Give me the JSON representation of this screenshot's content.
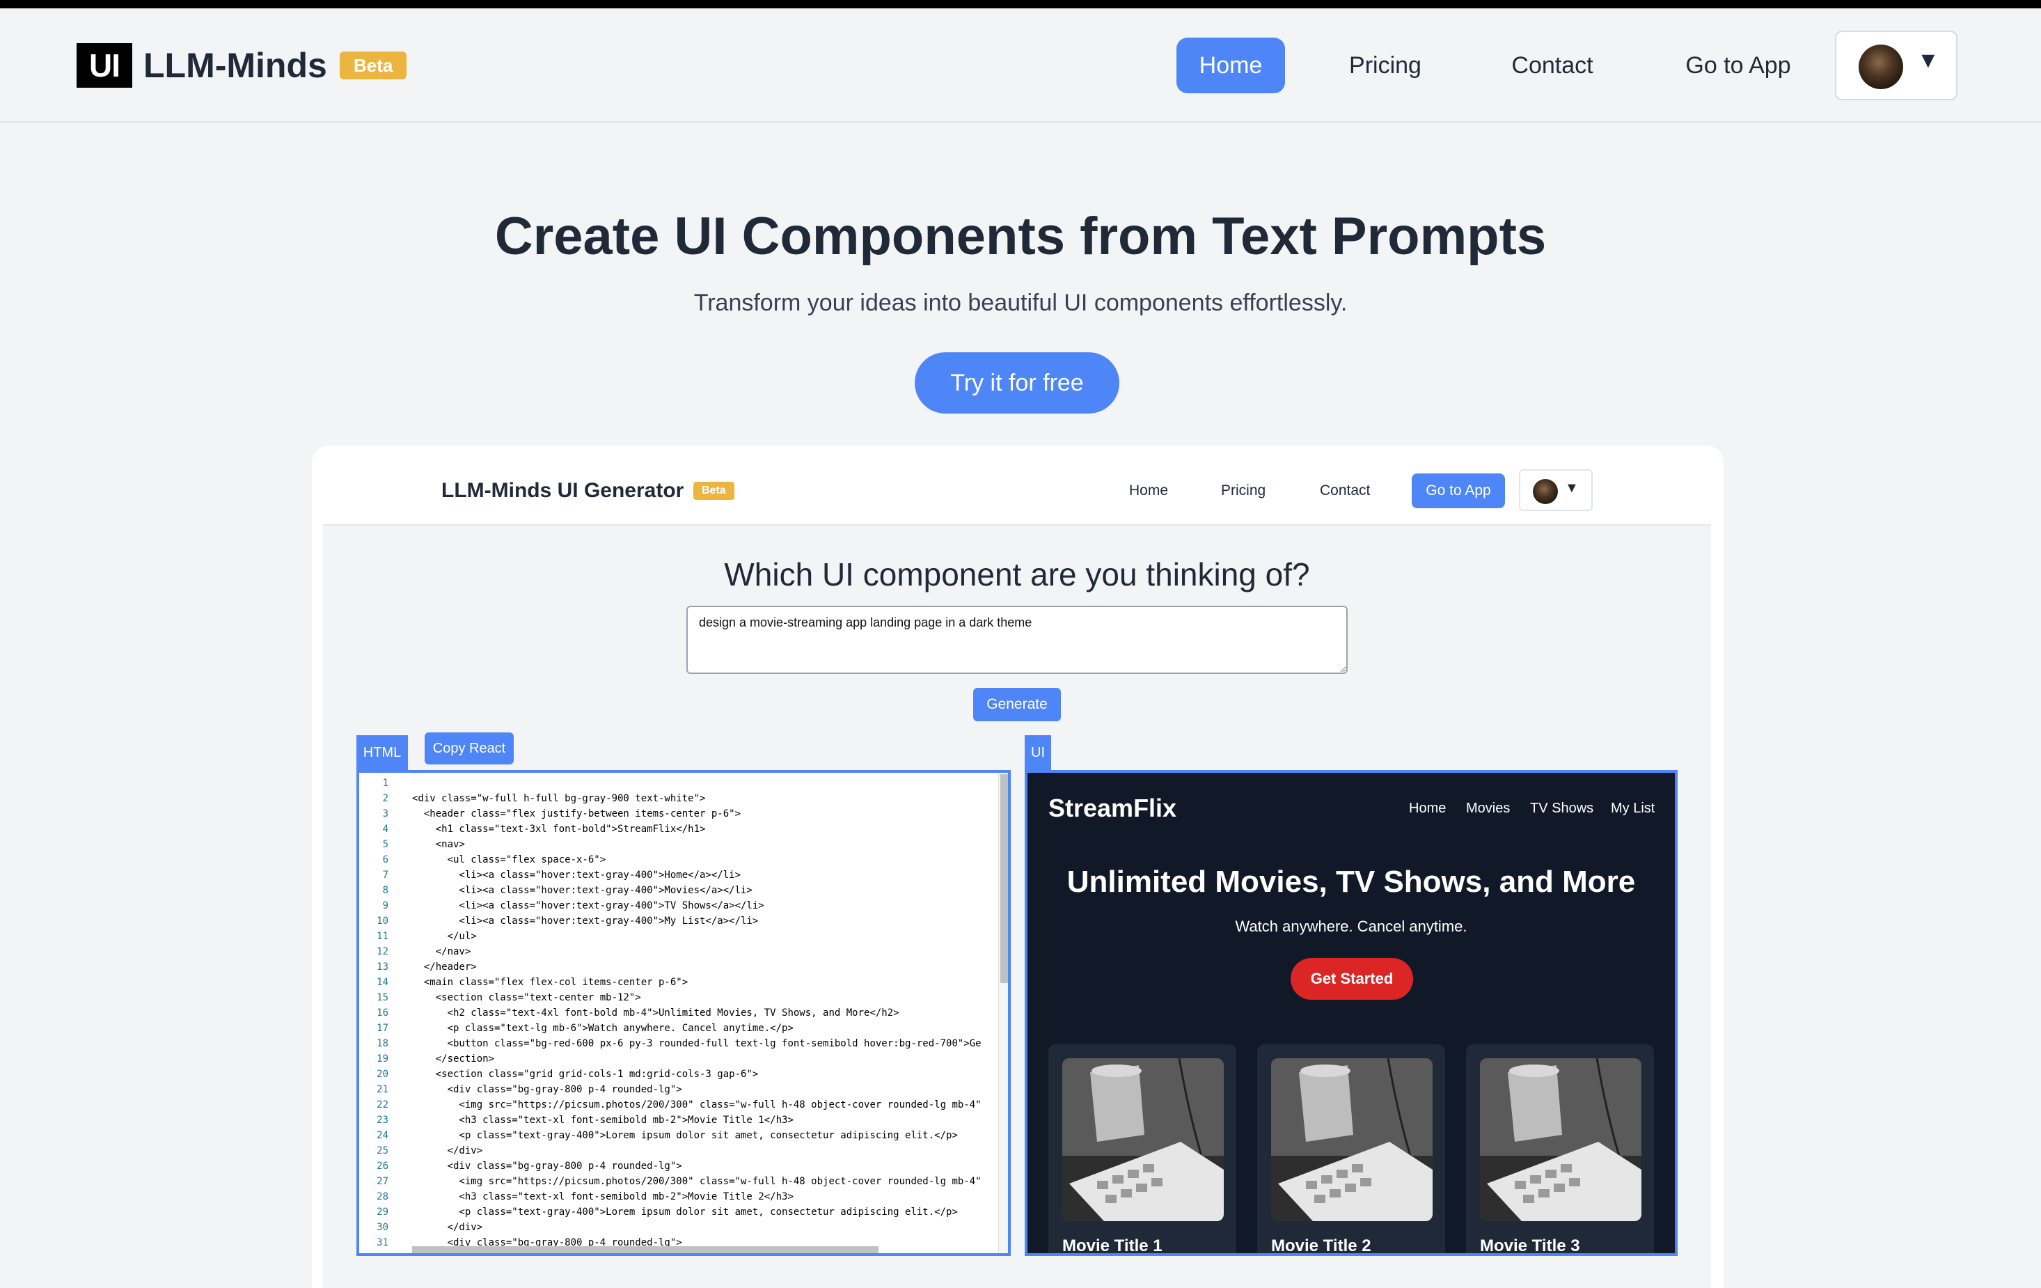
{
  "navbar": {
    "logo_text": "UI",
    "brand": "LLM-Minds",
    "badge": "Beta",
    "links": [
      "Home",
      "Pricing",
      "Contact",
      "Go to App"
    ],
    "caret": "▼"
  },
  "hero": {
    "title": "Create UI Components from Text Prompts",
    "subtitle": "Transform your ideas into beautiful UI components effortlessly.",
    "cta": "Try it for free"
  },
  "app": {
    "brand": "LLM-Minds UI Generator",
    "badge": "Beta",
    "links": [
      "Home",
      "Pricing",
      "Contact"
    ],
    "go_to_app": "Go to App",
    "caret": "▼",
    "question": "Which UI component are you thinking of?",
    "prompt_value": "design a movie-streaming app landing page in a dark theme",
    "generate_label": "Generate",
    "tab_html": "HTML",
    "copy_react": "Copy React",
    "tab_ui": "UI"
  },
  "code_lines": [
    "",
    "<div class=\"w-full h-full bg-gray-900 text-white\">",
    "  <header class=\"flex justify-between items-center p-6\">",
    "    <h1 class=\"text-3xl font-bold\">StreamFlix</h1>",
    "    <nav>",
    "      <ul class=\"flex space-x-6\">",
    "        <li><a class=\"hover:text-gray-400\">Home</a></li>",
    "        <li><a class=\"hover:text-gray-400\">Movies</a></li>",
    "        <li><a class=\"hover:text-gray-400\">TV Shows</a></li>",
    "        <li><a class=\"hover:text-gray-400\">My List</a></li>",
    "      </ul>",
    "    </nav>",
    "  </header>",
    "  <main class=\"flex flex-col items-center p-6\">",
    "    <section class=\"text-center mb-12\">",
    "      <h2 class=\"text-4xl font-bold mb-4\">Unlimited Movies, TV Shows, and More</h2>",
    "      <p class=\"text-lg mb-6\">Watch anywhere. Cancel anytime.</p>",
    "      <button class=\"bg-red-600 px-6 py-3 rounded-full text-lg font-semibold hover:bg-red-700\">Ge",
    "    </section>",
    "    <section class=\"grid grid-cols-1 md:grid-cols-3 gap-6\">",
    "      <div class=\"bg-gray-800 p-4 rounded-lg\">",
    "        <img src=\"https://picsum.photos/200/300\" class=\"w-full h-48 object-cover rounded-lg mb-4\"",
    "        <h3 class=\"text-xl font-semibold mb-2\">Movie Title 1</h3>",
    "        <p class=\"text-gray-400\">Lorem ipsum dolor sit amet, consectetur adipiscing elit.</p>",
    "      </div>",
    "      <div class=\"bg-gray-800 p-4 rounded-lg\">",
    "        <img src=\"https://picsum.photos/200/300\" class=\"w-full h-48 object-cover rounded-lg mb-4\"",
    "        <h3 class=\"text-xl font-semibold mb-2\">Movie Title 2</h3>",
    "        <p class=\"text-gray-400\">Lorem ipsum dolor sit amet, consectetur adipiscing elit.</p>",
    "      </div>",
    "      <div class=\"bg-gray-800 p-4 rounded-lg\">"
  ],
  "preview": {
    "brand": "StreamFlix",
    "nav": [
      "Home",
      "Movies",
      "TV Shows",
      "My List"
    ],
    "title": "Unlimited Movies, TV Shows, and More",
    "subtitle": "Watch anywhere. Cancel anytime.",
    "cta": "Get Started",
    "cards": [
      "Movie Title 1",
      "Movie Title 2",
      "Movie Title 3"
    ]
  },
  "colors": {
    "accent": "#4f86f7",
    "badge": "#ecb53f",
    "preview_bg": "#111827",
    "preview_card": "#1f2937",
    "cta_red": "#dc2626"
  }
}
